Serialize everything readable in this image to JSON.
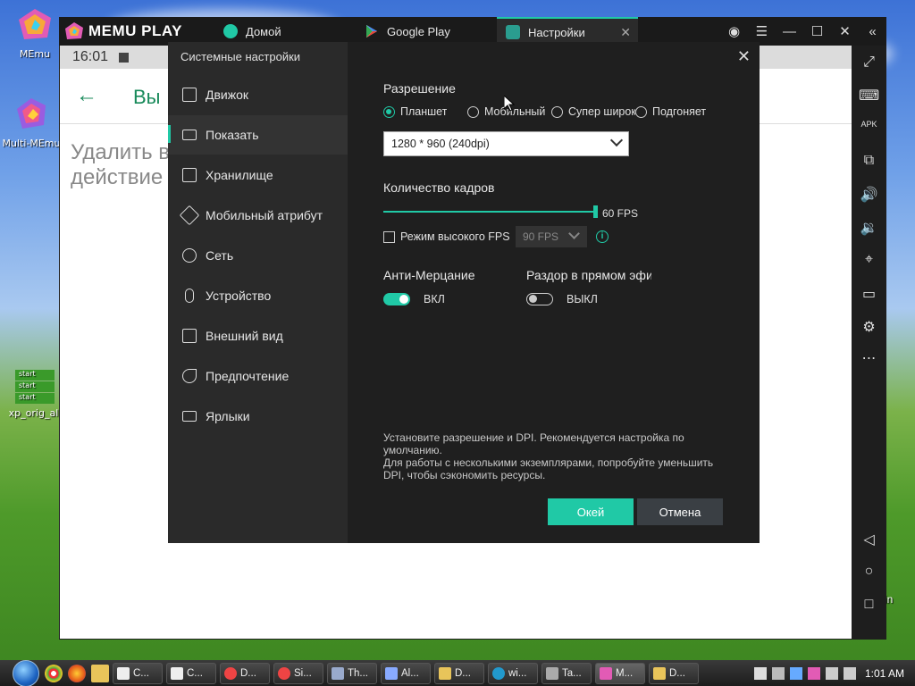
{
  "desktop": {
    "icons": [
      {
        "label": "MEmu"
      },
      {
        "label": "Multi-MEmu"
      },
      {
        "label": "xp_orig_all",
        "badges": [
          "start",
          "start",
          "start"
        ]
      }
    ],
    "partial_right_label": "in"
  },
  "memu": {
    "logo_text": "MEMU PLAY",
    "tabs": [
      {
        "label": "Домой",
        "icon": "home-app-icon"
      },
      {
        "label": "Google Play",
        "icon": "google-play-icon"
      },
      {
        "label": "Настройки",
        "icon": "gear-icon"
      }
    ],
    "window_controls": [
      "account-icon",
      "menu-icon",
      "minimize-icon",
      "maximize-icon",
      "close-icon",
      "collapse-sidebar-icon"
    ]
  },
  "android": {
    "time": "16:01",
    "appbar_title": "Вы",
    "behind_text_line1": "Удалить в",
    "behind_text_line2": "действие"
  },
  "side_tools": [
    "fullscreen-icon",
    "keyboard-icon",
    "apk-icon",
    "multi-window-icon",
    "volume-up-icon",
    "volume-down-icon",
    "location-icon",
    "folder-icon",
    "settings-icon",
    "more-icon",
    "back-icon",
    "home-icon",
    "recents-icon"
  ],
  "settings": {
    "title": "Системные настройки",
    "nav": [
      {
        "label": "Движок",
        "icon": "cpu-icon"
      },
      {
        "label": "Показать",
        "icon": "monitor-icon"
      },
      {
        "label": "Хранилище",
        "icon": "storage-icon"
      },
      {
        "label": "Мобильный атрибут",
        "icon": "tag-icon"
      },
      {
        "label": "Сеть",
        "icon": "globe-icon"
      },
      {
        "label": "Устройство",
        "icon": "mic-icon"
      },
      {
        "label": "Внешний вид",
        "icon": "window-icon"
      },
      {
        "label": "Предпочтение",
        "icon": "wrench-icon"
      },
      {
        "label": "Ярлыки",
        "icon": "keyboard-icon"
      }
    ],
    "active_nav": "Показать",
    "resolution": {
      "label": "Разрешение",
      "options": [
        "Планшет",
        "Мобильный",
        "Супер широк",
        "Подгоняет"
      ],
      "selected": "Планшет",
      "value": "1280 * 960 (240dpi)"
    },
    "fps": {
      "label": "Количество кадров",
      "value_text": "60 FPS",
      "level": 1.0,
      "high_fps_label": "Режим высокого FPS",
      "high_fps_checked": false,
      "high_fps_value": "90 FPS"
    },
    "anti_flicker": {
      "label": "Анти-Мерцание",
      "state": "ВКЛ",
      "on": true
    },
    "discord": {
      "label": "Раздор в прямом эфи",
      "state": "ВЫКЛ",
      "on": false
    },
    "description": "Установите разрешение и DPI. Рекомендуется настройка по умолчанию.\nДля работы с несколькими экземплярами, попробуйте уменьшить DPI, чтобы сэкономить ресурсы.",
    "ok_label": "Окей",
    "cancel_label": "Отмена"
  },
  "taskbar": {
    "buttons": [
      "C...",
      "C...",
      "D...",
      "Si...",
      "Th...",
      "Al...",
      "D...",
      "wi...",
      "Ta...",
      "M...",
      "D..."
    ],
    "clock": "1:01 AM"
  },
  "colors": {
    "accent": "#20c9a6",
    "dialog_bg": "#1f1f1f",
    "sidebar_bg": "#2a2a2a"
  }
}
